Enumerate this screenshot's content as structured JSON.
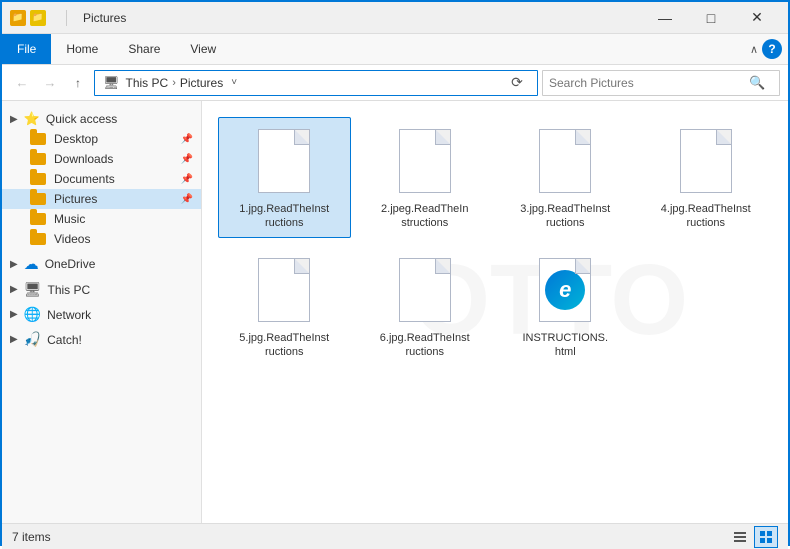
{
  "titleBar": {
    "title": "Pictures",
    "icons": [
      "folder-icon-1",
      "folder-icon-2"
    ],
    "controls": {
      "minimize": "—",
      "maximize": "□",
      "close": "✕"
    }
  },
  "ribbon": {
    "tabs": [
      {
        "label": "File",
        "active": true
      },
      {
        "label": "Home",
        "active": false
      },
      {
        "label": "Share",
        "active": false
      },
      {
        "label": "View",
        "active": false
      }
    ],
    "helpIcon": "?"
  },
  "addressBar": {
    "back": "←",
    "forward": "→",
    "up": "↑",
    "breadcrumb": {
      "thisPC": "This PC",
      "separator1": "›",
      "current": "Pictures"
    },
    "dropdown": "˅",
    "refresh": "⟳",
    "search": {
      "placeholder": "Search Pictures",
      "icon": "🔍"
    }
  },
  "sidebar": {
    "sections": [
      {
        "name": "quick-access",
        "label": "Quick access",
        "icon": "⭐",
        "items": [
          {
            "label": "Desktop",
            "icon": "folder",
            "pinned": true
          },
          {
            "label": "Downloads",
            "icon": "folder-download",
            "pinned": true
          },
          {
            "label": "Documents",
            "icon": "folder-doc",
            "pinned": true
          },
          {
            "label": "Pictures",
            "icon": "folder-pic",
            "pinned": true,
            "active": true
          },
          {
            "label": "Music",
            "icon": "folder-music",
            "pinned": false
          },
          {
            "label": "Videos",
            "icon": "folder-video",
            "pinned": false
          }
        ]
      },
      {
        "name": "onedrive",
        "label": "OneDrive",
        "icon": "cloud",
        "items": []
      },
      {
        "name": "this-pc",
        "label": "This PC",
        "icon": "pc",
        "items": []
      },
      {
        "name": "network",
        "label": "Network",
        "icon": "network",
        "items": []
      },
      {
        "name": "catch",
        "label": "Catch!",
        "icon": "catch",
        "items": []
      }
    ]
  },
  "content": {
    "files": [
      {
        "id": 1,
        "name": "1.jpg.ReadTheInstructions",
        "type": "generic",
        "selected": true
      },
      {
        "id": 2,
        "name": "2.jpeg.ReadTheInstructions",
        "type": "generic",
        "selected": false
      },
      {
        "id": 3,
        "name": "3.jpg.ReadTheInstructions",
        "type": "generic",
        "selected": false
      },
      {
        "id": 4,
        "name": "4.jpg.ReadTheInstructions",
        "type": "generic",
        "selected": false
      },
      {
        "id": 5,
        "name": "5.jpg.ReadTheInstructions",
        "type": "generic",
        "selected": false
      },
      {
        "id": 6,
        "name": "6.jpg.ReadTheInstructions",
        "type": "generic",
        "selected": false
      },
      {
        "id": 7,
        "name": "INSTRUCTIONS.html",
        "type": "html",
        "selected": false
      }
    ],
    "watermark": "OTTO"
  },
  "statusBar": {
    "itemCount": "7 items",
    "viewModes": [
      {
        "icon": "☰☰",
        "name": "list-view",
        "active": false
      },
      {
        "icon": "⊞",
        "name": "icon-view",
        "active": true
      }
    ]
  }
}
